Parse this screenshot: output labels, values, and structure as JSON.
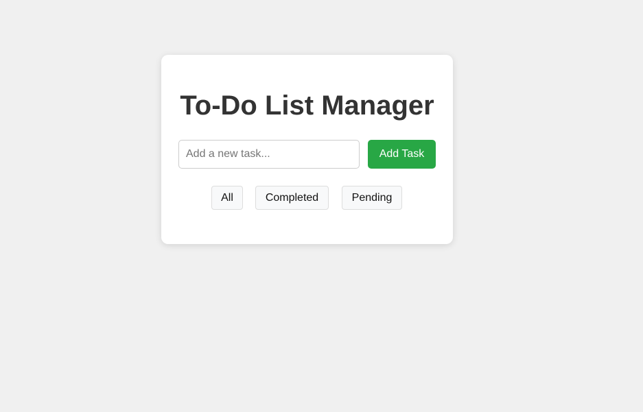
{
  "app": {
    "title": "To-Do List Manager"
  },
  "new_task": {
    "value": "",
    "placeholder": "Add a new task..."
  },
  "add_button": {
    "label": "Add Task",
    "color": "#28a745"
  },
  "filters": [
    {
      "label": "All"
    },
    {
      "label": "Completed"
    },
    {
      "label": "Pending"
    }
  ]
}
